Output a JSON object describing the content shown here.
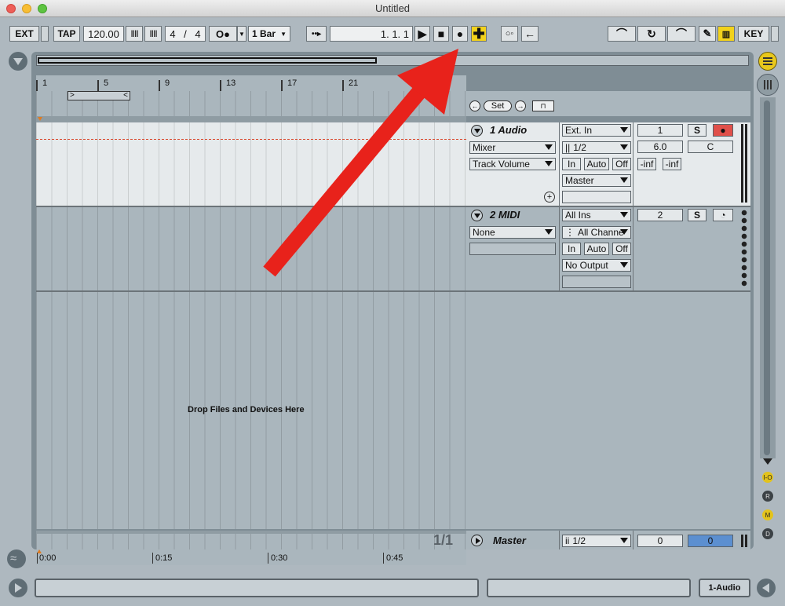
{
  "window": {
    "title": "Untitled"
  },
  "control_bar": {
    "ext": "EXT",
    "tap": "TAP",
    "tempo": "120.00",
    "signature_num": "4",
    "signature_sep": "/",
    "signature_den": "4",
    "quantize": "1 Bar",
    "position": "1.   1.   1",
    "key": "KEY"
  },
  "arrangement": {
    "ruler_ticks": [
      "1",
      "5",
      "9",
      "13",
      "17",
      "21"
    ],
    "time_ticks": [
      "0:00",
      "0:15",
      "0:30",
      "0:45"
    ],
    "drop_text": "Drop Files and Devices Here",
    "page_indicator": "1/1",
    "set_label": "Set"
  },
  "tracks": [
    {
      "name": "1 Audio",
      "input_type": "Ext. In",
      "input_channel": "1/2",
      "device_chooser": "Mixer",
      "control_chooser": "Track Volume",
      "monitor": [
        "In",
        "Auto",
        "Off"
      ],
      "output": "Master",
      "number": "1",
      "volume": "6.0",
      "pan": "C",
      "solo": "S",
      "meter_left": "-inf",
      "meter_right": "-inf"
    },
    {
      "name": "2 MIDI",
      "input_type": "All Ins",
      "input_channel": "All Channe",
      "device_chooser": "None",
      "monitor": [
        "In",
        "Auto",
        "Off"
      ],
      "output": "No Output",
      "number": "2",
      "solo": "S"
    }
  ],
  "master": {
    "name": "Master",
    "output_channel": "1/2",
    "left_value": "0",
    "right_value": "0"
  },
  "side_status": [
    "I-O",
    "R",
    "M",
    "D"
  ],
  "status_bar": {
    "selected_track": "1-Audio"
  },
  "colors": {
    "accent_yellow": "#f2d21c",
    "accent_orange": "#e59c4a",
    "annotation_arrow": "#e8221b"
  }
}
